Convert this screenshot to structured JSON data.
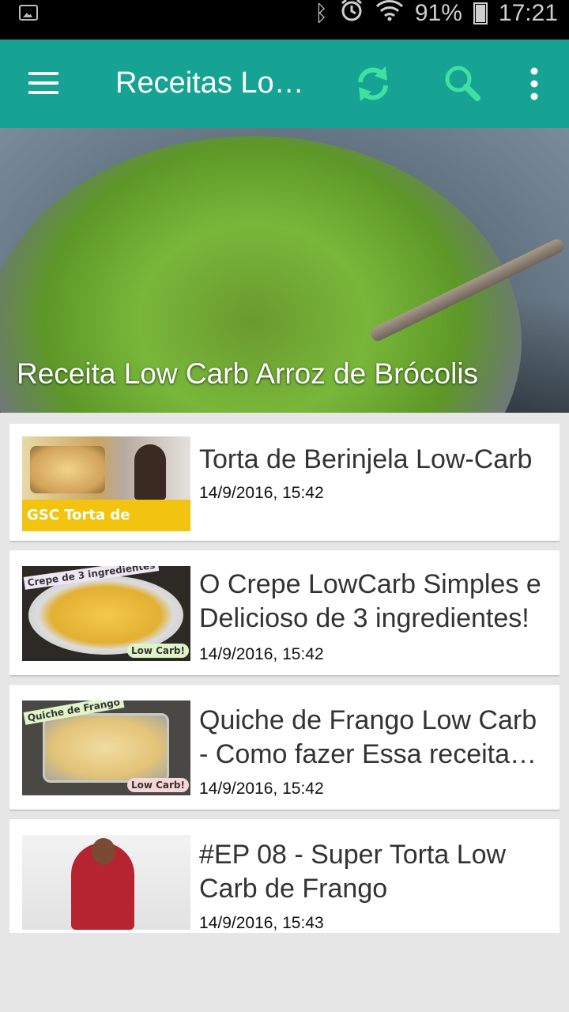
{
  "status": {
    "battery": "91%",
    "time": "17:21"
  },
  "app": {
    "title": "Receitas Low Carb"
  },
  "colors": {
    "appbar": "#16a394",
    "accent": "#40e0a0"
  },
  "hero": {
    "caption": "Receita Low Carb Arroz de Brócolis"
  },
  "cards": [
    {
      "title": "Torta de Berinjela Low-Carb",
      "date": "14/9/2016, 15:42",
      "thumb_text": "GSC Torta de Berinjela"
    },
    {
      "title": "O Crepe LowCarb Simples e Delicioso de 3 ingredientes!",
      "date": "14/9/2016, 15:42",
      "thumb_text": "Crepe de 3 ingredientes",
      "thumb_badge": "Low Carb!"
    },
    {
      "title": "Quiche de Frango Low Carb - Como fazer Essa receita deliciosa",
      "date": "14/9/2016, 15:42",
      "thumb_text": "Quiche de Frango",
      "thumb_badge": "Low Carb!"
    },
    {
      "title": "#EP 08 - Super Torta Low Carb de Frango",
      "date": "14/9/2016, 15:43"
    }
  ]
}
